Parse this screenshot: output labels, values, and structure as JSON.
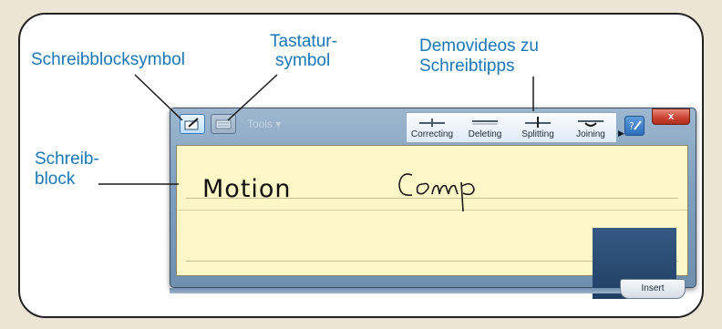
{
  "callouts": {
    "pad_icon": "Schreibblocksymbol",
    "keyboard_icon_line1": "Tastatur-",
    "keyboard_icon_line2": "symbol",
    "demo_videos_line1": "Demovideos zu",
    "demo_videos_line2": "Schreibtipps",
    "pad_line1": "Schreib-",
    "pad_line2": "block"
  },
  "toolbar": {
    "tools_label": "Tools ▾",
    "pad_icon": "pen-pad-icon",
    "keyboard_icon": "keyboard-icon",
    "help_icon": "help-icon",
    "close_label": "x"
  },
  "demo_videos": [
    {
      "label": "Correcting",
      "icon": "correcting-gesture-icon"
    },
    {
      "label": "Deleting",
      "icon": "deleting-gesture-icon"
    },
    {
      "label": "Splitting",
      "icon": "splitting-gesture-icon"
    },
    {
      "label": "Joining",
      "icon": "joining-gesture-icon"
    }
  ],
  "writing_pad": {
    "recognized_text": "Motion",
    "handwriting_text": "Comp"
  },
  "insert_label": "Insert",
  "colors": {
    "callout_text": "#1777b8",
    "callout_line": "#1a1a1a",
    "pad_background": "#fdf6c7",
    "window_frame": "#7f9fbe",
    "close_button": "#c8402e"
  }
}
